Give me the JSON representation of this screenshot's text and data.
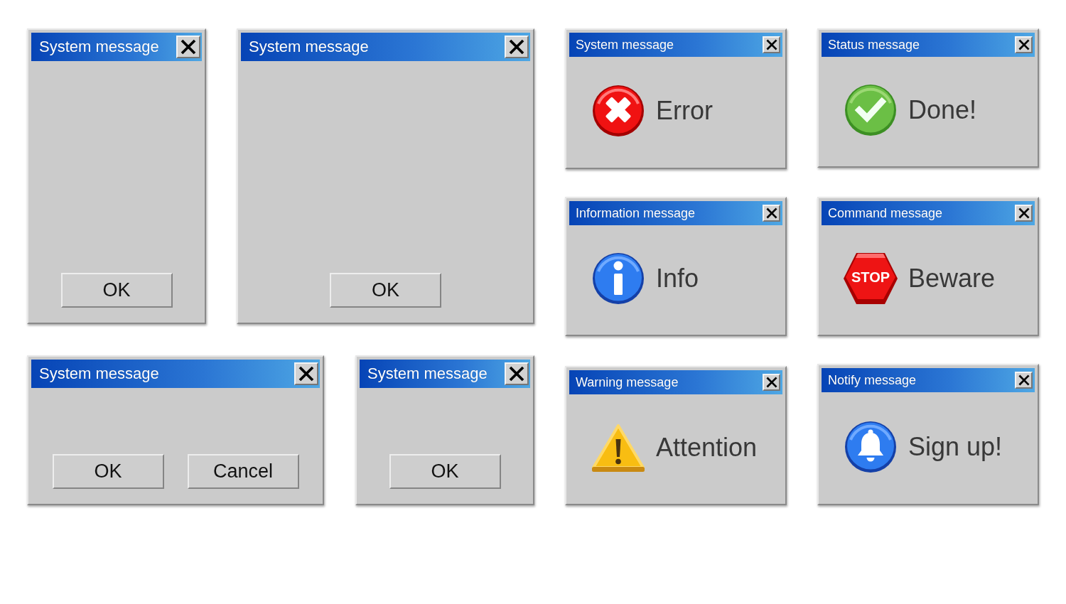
{
  "dialogs": [
    {
      "kind": "buttons",
      "title": "System message",
      "buttons": [
        "OK"
      ]
    },
    {
      "kind": "buttons",
      "title": "System message",
      "buttons": [
        "OK"
      ]
    },
    {
      "kind": "error",
      "title": "System message",
      "message": "Error"
    },
    {
      "kind": "success",
      "title": "Status message",
      "message": "Done!"
    },
    {
      "kind": "info",
      "title": "Information message",
      "message": "Info"
    },
    {
      "kind": "stop",
      "title": "Command message",
      "sign": "STOP",
      "message": "Beware"
    },
    {
      "kind": "buttons",
      "title": "System message",
      "buttons": [
        "OK",
        "Cancel"
      ]
    },
    {
      "kind": "buttons",
      "title": "System message",
      "buttons": [
        "OK"
      ]
    },
    {
      "kind": "warning",
      "title": "Warning message",
      "message": "Attention"
    },
    {
      "kind": "notify",
      "title": "Notify message",
      "message": "Sign up!"
    }
  ]
}
